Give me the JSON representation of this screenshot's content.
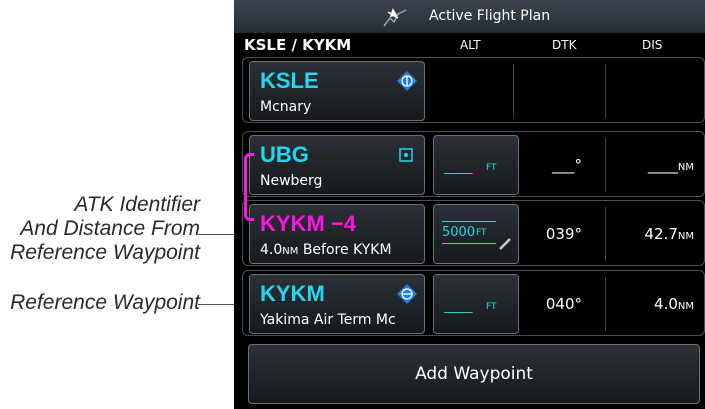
{
  "callouts": {
    "atk": "ATK Identifier And Distance From Reference Waypoint",
    "atk_lines": [
      "ATK Identifier",
      "And Distance From",
      "Reference Waypoint"
    ],
    "reference": "Reference Waypoint"
  },
  "titlebar": {
    "title": "Active Flight Plan",
    "icon": "airplane-route-icon"
  },
  "header": {
    "route": "KSLE / KYKM",
    "col_alt": "ALT",
    "col_dtk": "DTK",
    "col_dis": "DIS"
  },
  "rows": [
    {
      "id": "KSLE",
      "name": "Mcnary",
      "icon": "airport-icon",
      "alt": "",
      "dtk": "",
      "dis": "",
      "color": "#22d8ee"
    },
    {
      "id": "UBG",
      "name": "Newberg",
      "icon": "vor-icon",
      "alt": "_____",
      "alt_unit": "FT",
      "dtk": "___°",
      "dis": "____",
      "dis_unit": "NM",
      "color": "#22d8ee"
    },
    {
      "id": "KYKM −4",
      "name_prefix": "4.0",
      "name_unit": "NM",
      "name_suffix": " Before KYKM",
      "icon": "",
      "alt": "5000",
      "alt_unit": "FT",
      "dtk": "039°",
      "dis": "42.7",
      "dis_unit": "NM",
      "color": "#ff14e6"
    },
    {
      "id": "KYKM",
      "name": "Yakima Air Term Mc",
      "icon": "airport-icon",
      "alt": "_____",
      "alt_unit": "FT",
      "dtk": "040°",
      "dis": "4.0",
      "dis_unit": "NM",
      "color": "#22d8ee"
    }
  ],
  "add_button": "Add Waypoint",
  "colors": {
    "cyan": "#22d8ee",
    "magenta": "#ff14e6"
  }
}
